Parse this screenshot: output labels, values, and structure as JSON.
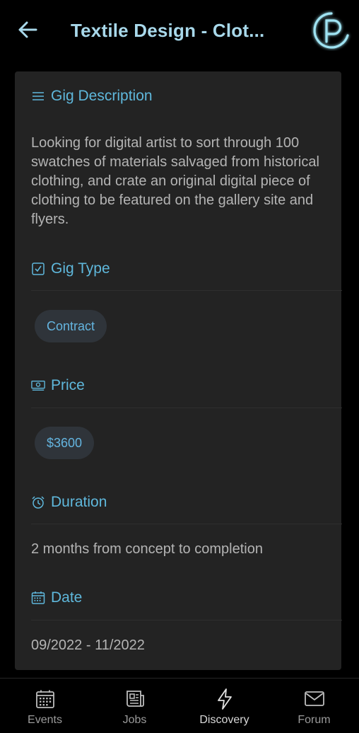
{
  "header": {
    "title": "Textile Design - Clot...",
    "back_icon": "arrow-left-icon",
    "logo_icon": "p-logo-icon"
  },
  "sections": {
    "description": {
      "label": "Gig Description",
      "icon": "menu-lines-icon",
      "text": "Looking for digital artist to sort through 100 swatches of materials salvaged from historical clothing, and crate an original digital piece of clothing to be featured on the gallery site and flyers."
    },
    "type": {
      "label": "Gig Type",
      "icon": "checkbox-icon",
      "value": "Contract"
    },
    "price": {
      "label": "Price",
      "icon": "money-icon",
      "value": "$3600"
    },
    "duration": {
      "label": "Duration",
      "icon": "alarm-clock-icon",
      "value": "2 months from concept to completion"
    },
    "date": {
      "label": "Date",
      "icon": "calendar-icon",
      "value": "09/2022 - 11/2022"
    }
  },
  "nav": {
    "items": [
      {
        "label": "Events",
        "icon": "calendar-grid-icon"
      },
      {
        "label": "Jobs",
        "icon": "newspaper-icon"
      },
      {
        "label": "Discovery",
        "icon": "lightning-icon",
        "active": true
      },
      {
        "label": "Forum",
        "icon": "mail-icon"
      }
    ]
  },
  "colors": {
    "accent": "#5fb8dc",
    "title": "#a8d8ea",
    "card_bg": "#232323",
    "chip_bg": "#2f343a",
    "background": "#000000"
  }
}
